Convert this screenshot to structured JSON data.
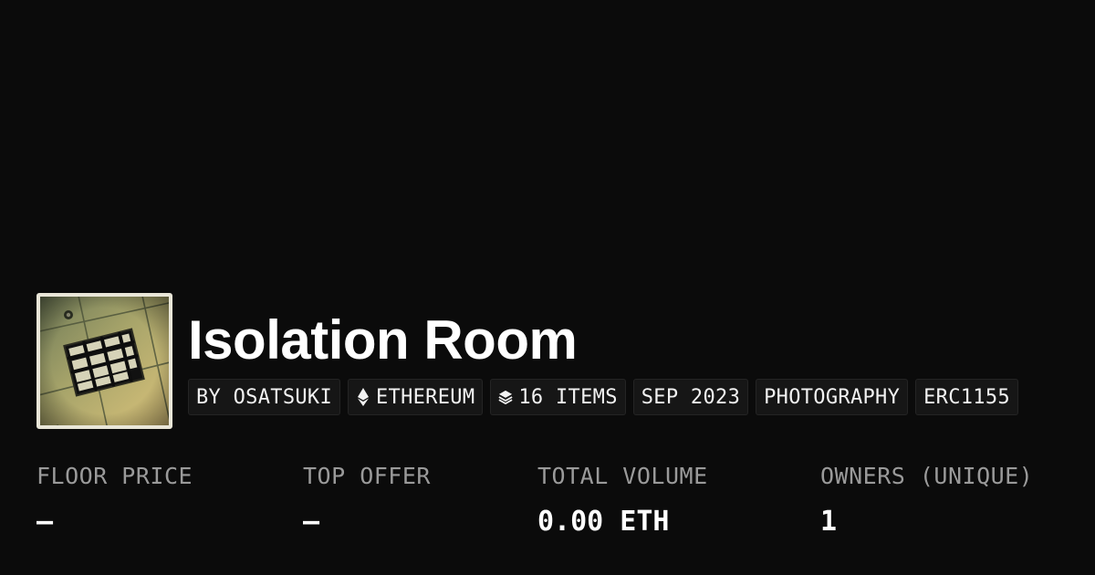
{
  "collection": {
    "title": "Isolation Room",
    "avatar_icon": "collection-photo-thumbnail"
  },
  "tags": {
    "creator": "BY OSATSUKI",
    "chain": "ETHEREUM",
    "chain_icon": "ethereum-icon",
    "items": "16 ITEMS",
    "items_icon": "layers-icon",
    "date": "SEP 2023",
    "category": "PHOTOGRAPHY",
    "standard": "ERC1155"
  },
  "stats": {
    "floor_price": {
      "label": "FLOOR PRICE",
      "value": "–"
    },
    "top_offer": {
      "label": "TOP OFFER",
      "value": "–"
    },
    "total_volume": {
      "label": "TOTAL VOLUME",
      "value": "0.00 ETH"
    },
    "owners": {
      "label": "OWNERS (UNIQUE)",
      "value": "1"
    }
  },
  "colors": {
    "background": "#0b0b0b",
    "text": "#ffffff",
    "muted": "#9a9a9a",
    "tag_bg": "#161616"
  }
}
